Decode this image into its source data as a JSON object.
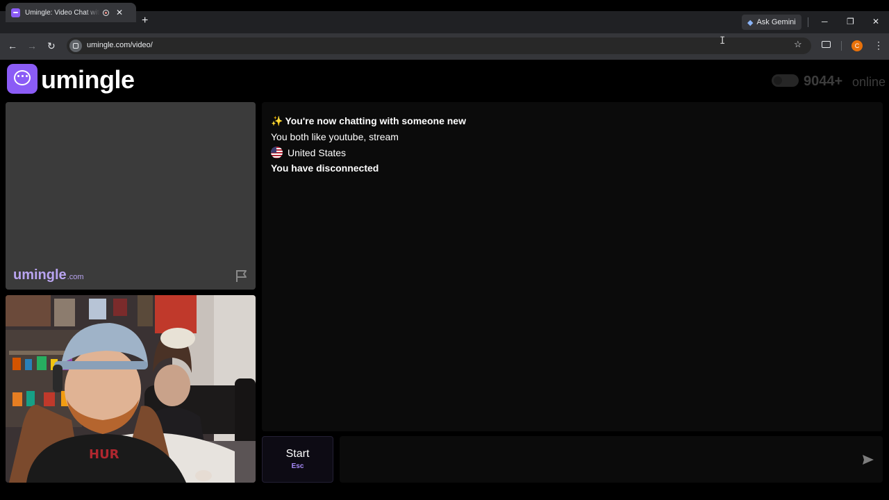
{
  "browser": {
    "tab_title": "Umingle: Video Chat with Strangers",
    "tab_close": "✕",
    "new_tab": "+",
    "ask_gemini": "Ask Gemini",
    "window_minimize": "─",
    "window_restore": "❐",
    "window_close": "✕",
    "nav_back": "←",
    "nav_forward": "→",
    "nav_reload": "↻",
    "url": "umingle.com/video/",
    "bookmark_star": "☆",
    "profile_initial": "C",
    "menu": "⋮",
    "text_cursor": "I"
  },
  "header": {
    "brand": "umingle",
    "online_count": "9044+",
    "online_label": "online"
  },
  "stranger_video": {
    "watermark_main": "umingle",
    "watermark_domain": ".com"
  },
  "chat": {
    "sparkles": "✨",
    "messages": {
      "new_chat": "You're now chatting with someone new",
      "interests": "You both like youtube, stream",
      "country": "United States",
      "disconnected": "You have disconnected"
    }
  },
  "controls": {
    "start_label": "Start",
    "start_hint": "Esc",
    "message_placeholder": ""
  },
  "colors": {
    "brand_purple": "#8b5cf6",
    "watermark": "#b9a4f0",
    "esc_hint": "#a78bfa"
  },
  "icons": [
    "tab-favicon-icon",
    "record-icon",
    "gemini-icon",
    "site-info-icon",
    "star-icon",
    "cast-icon",
    "logo-icon",
    "flag-icon",
    "us-flag-icon",
    "send-icon"
  ]
}
